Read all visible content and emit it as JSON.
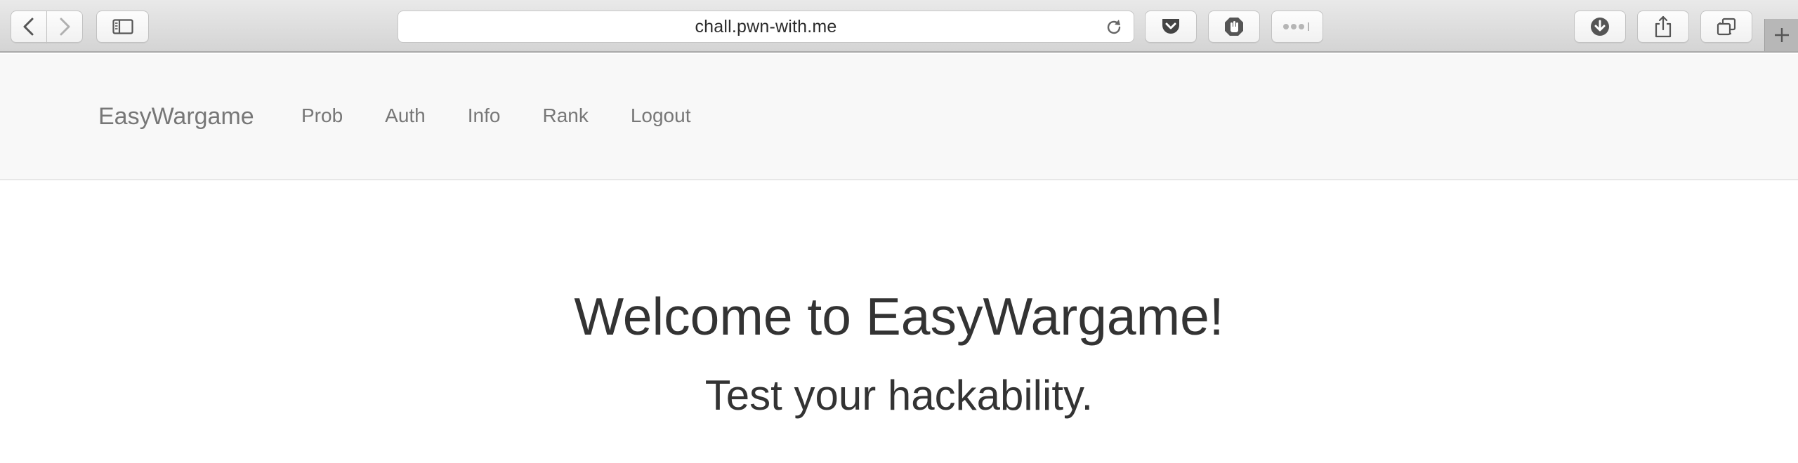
{
  "browser": {
    "url": "chall.pwn-with.me",
    "icons": {
      "back": "chevron-left-icon",
      "forward": "chevron-right-icon",
      "sidebar": "sidebar-icon",
      "reload": "reload-icon",
      "pocket": "pocket-icon",
      "ublock": "ublock-hand-icon",
      "more": "more-dots-icon",
      "download": "download-icon",
      "share": "share-icon",
      "tabs": "tabs-overview-icon",
      "new_tab": "plus-icon"
    }
  },
  "navbar": {
    "brand": "EasyWargame",
    "links": [
      "Prob",
      "Auth",
      "Info",
      "Rank",
      "Logout"
    ]
  },
  "main": {
    "headline": "Welcome to EasyWargame!",
    "tagline": "Test your hackability."
  },
  "colors": {
    "navbar_bg": "#f8f8f8",
    "nav_text": "#777777",
    "heading_text": "#333333"
  }
}
